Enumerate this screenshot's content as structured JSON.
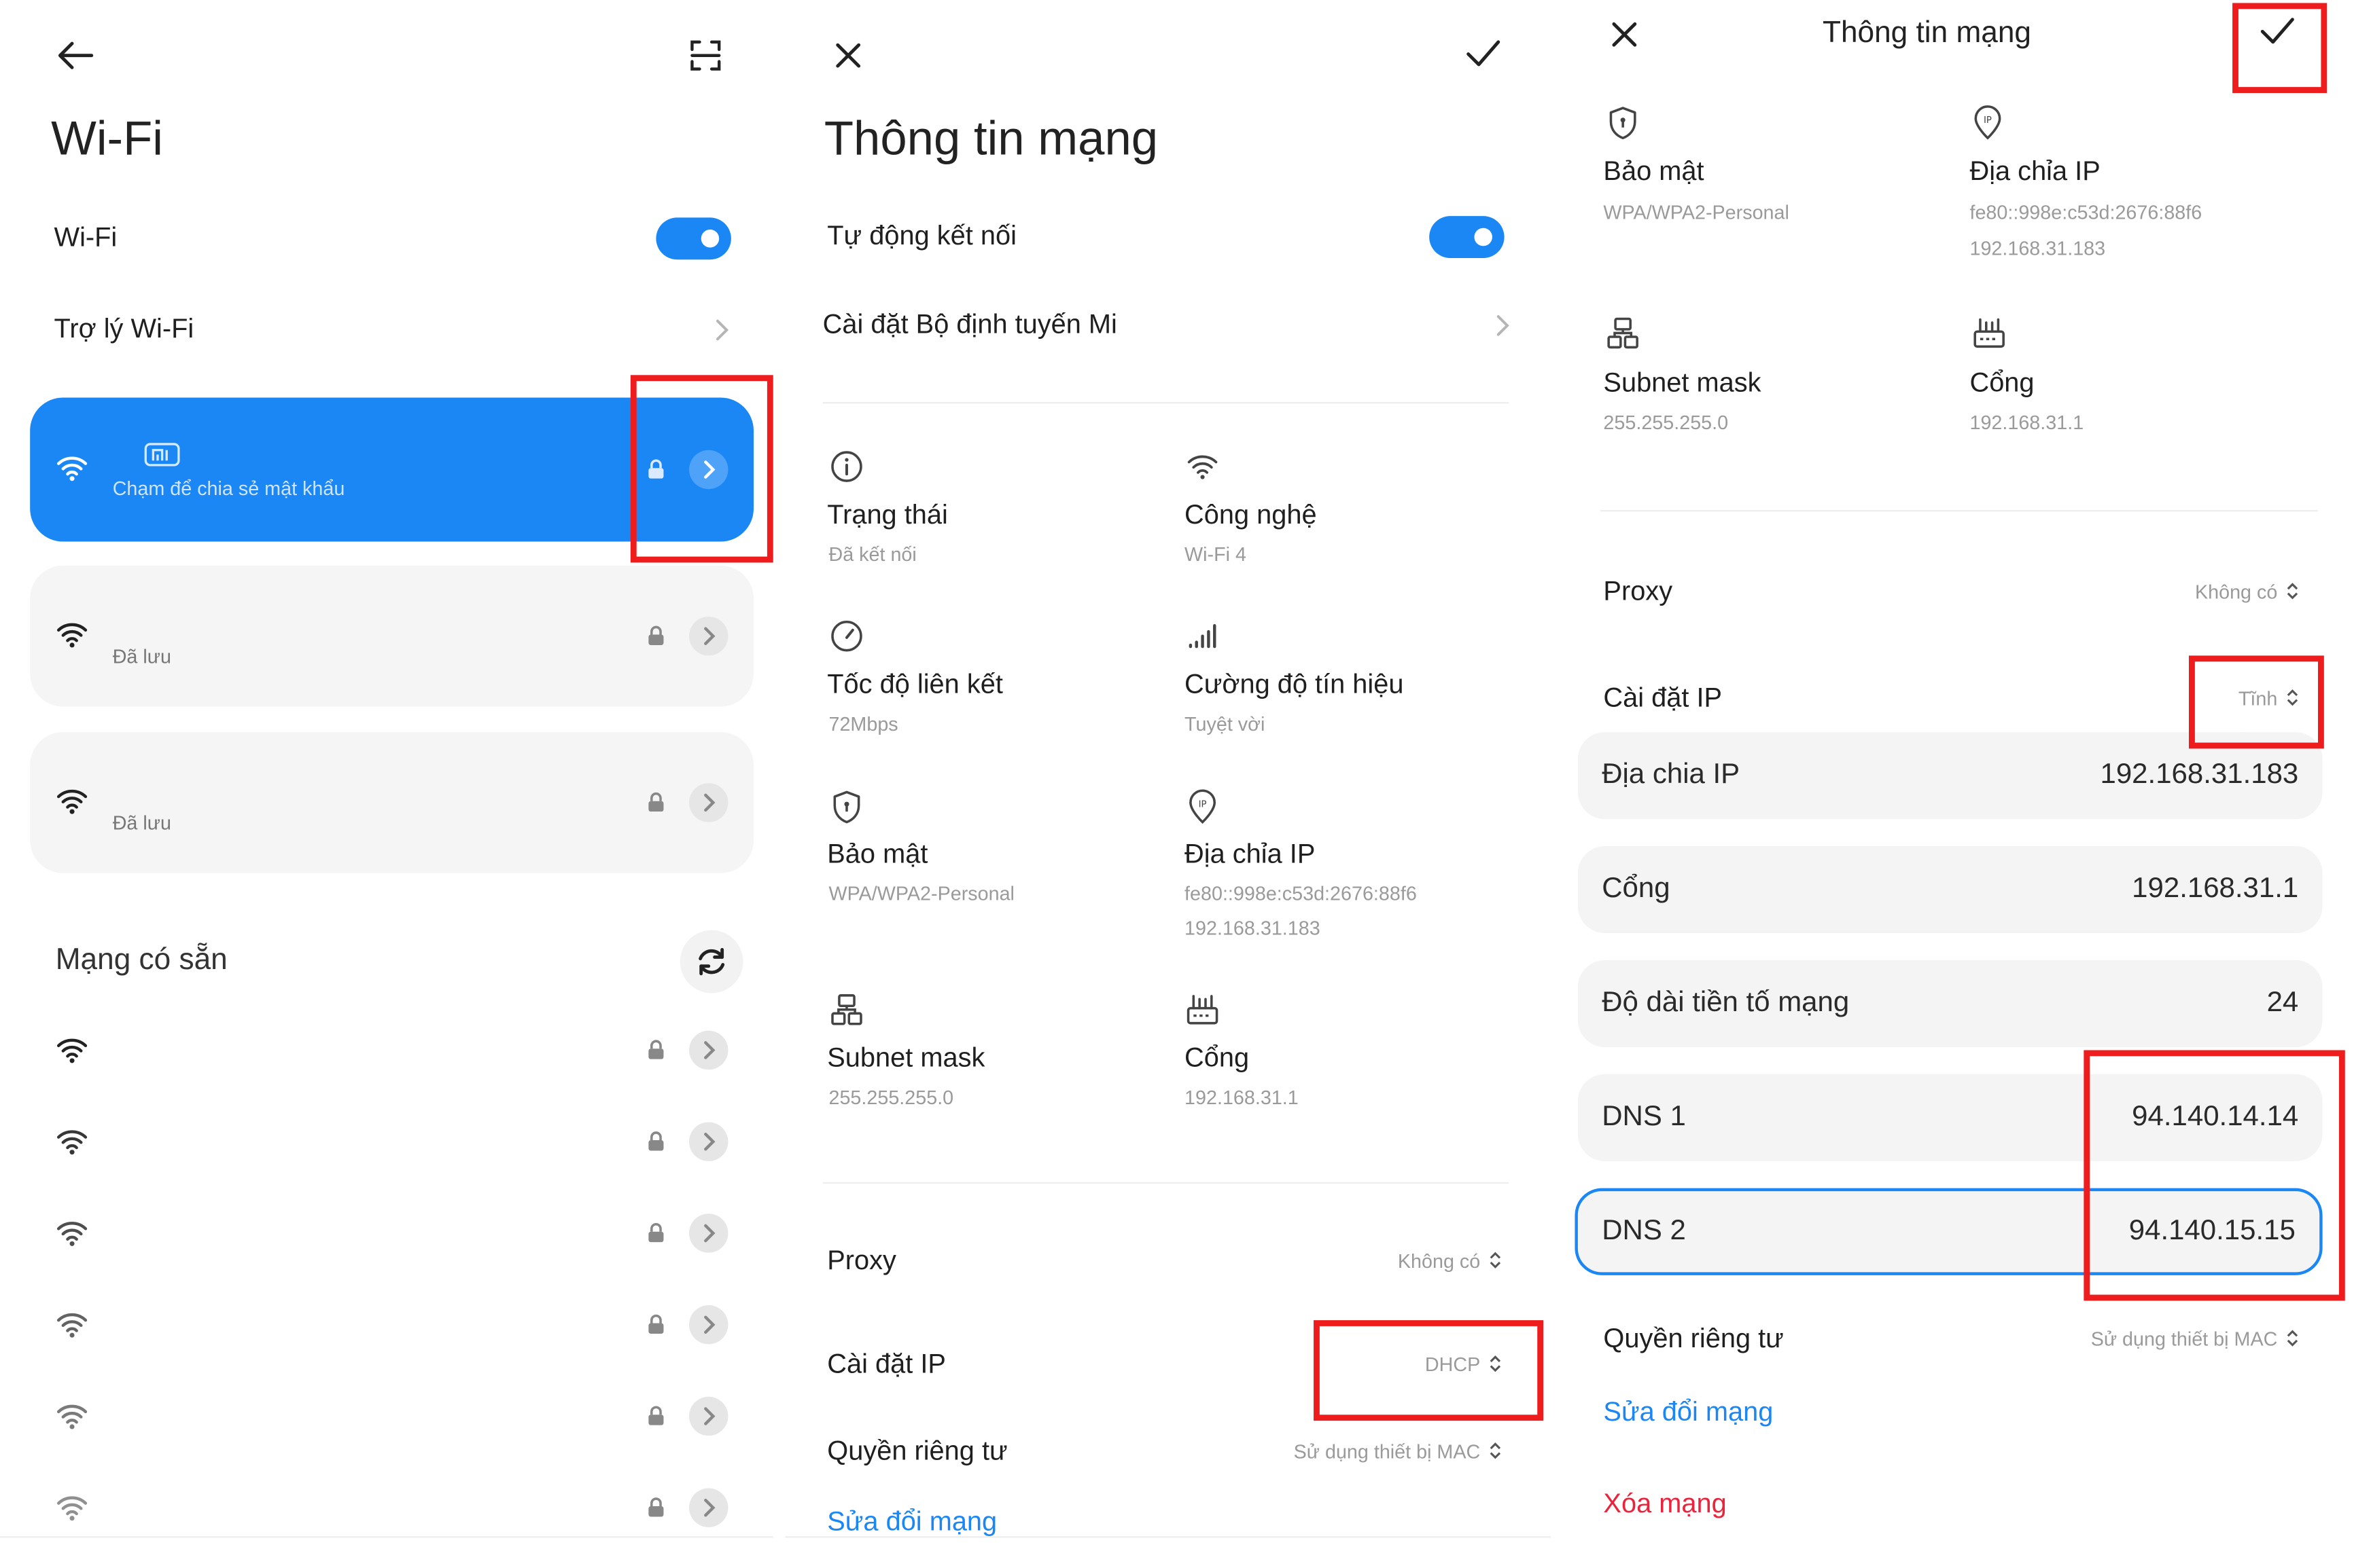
{
  "panel1": {
    "title": "Wi-Fi",
    "wifi_label": "Wi-Fi",
    "assistant_label": "Trợ lý Wi-Fi",
    "connected_subtitle": "Chạm để chia sẻ mật khẩu",
    "saved_networks": [
      "Đã lưu",
      "Đã lưu"
    ],
    "available_title": "Mạng có sẵn",
    "available_count_rows": 6
  },
  "panel2": {
    "title": "Thông tin mạng",
    "auto_connect_label": "Tự động kết nối",
    "router_label": "Cài đặt Bộ định tuyến Mi",
    "info": [
      {
        "label": "Trạng thái",
        "value": "Đã kết nối",
        "icon": "info-icon"
      },
      {
        "label": "Công nghệ",
        "value": "Wi-Fi 4",
        "icon": "wifi-icon"
      },
      {
        "label": "Tốc độ liên kết",
        "value": "72Mbps",
        "icon": "speed-gauge-icon"
      },
      {
        "label": "Cường độ tín hiệu",
        "value": "Tuyệt vời",
        "icon": "signal-bars-icon"
      },
      {
        "label": "Bảo mật",
        "value": "WPA/WPA2-Personal",
        "icon": "shield-icon"
      },
      {
        "label": "Địa chỉa IP",
        "value": "fe80::998e:c53d:2676:88f6",
        "value2": "192.168.31.183",
        "icon": "ip-pin-icon"
      },
      {
        "label": "Subnet mask",
        "value": "255.255.255.0",
        "icon": "subnet-icon"
      },
      {
        "label": "Cổng",
        "value": "192.168.31.1",
        "icon": "router-icon"
      }
    ],
    "proxy_label": "Proxy",
    "proxy_value": "Không có",
    "ip_settings_label": "Cài đặt IP",
    "ip_settings_value": "DHCP",
    "privacy_label": "Quyền riêng tư",
    "privacy_value": "Sử dụng thiết bị MAC",
    "modify_label": "Sửa đổi mạng"
  },
  "panel3": {
    "title": "Thông tin mạng",
    "info": [
      {
        "label": "Bảo mật",
        "value": "WPA/WPA2-Personal",
        "icon": "shield-icon"
      },
      {
        "label": "Địa chỉa IP",
        "value": "fe80::998e:c53d:2676:88f6",
        "value2": "192.168.31.183",
        "icon": "ip-pin-icon"
      },
      {
        "label": "Subnet mask",
        "value": "255.255.255.0",
        "icon": "subnet-icon"
      },
      {
        "label": "Cổng",
        "value": "192.168.31.1",
        "icon": "router-icon"
      }
    ],
    "proxy_label": "Proxy",
    "proxy_value": "Không có",
    "ip_settings_label": "Cài đặt IP",
    "ip_settings_value": "Tĩnh",
    "fields": [
      {
        "label": "Địa chia IP",
        "value": "192.168.31.183"
      },
      {
        "label": "Cổng",
        "value": "192.168.31.1"
      },
      {
        "label": "Độ dài tiền tố mạng",
        "value": "24"
      },
      {
        "label": "DNS 1",
        "value": "94.140.14.14"
      },
      {
        "label": "DNS 2",
        "value": "94.140.15.15"
      }
    ],
    "privacy_label": "Quyền riêng tư",
    "privacy_value": "Sử dụng thiết bị MAC",
    "modify_label": "Sửa đổi mạng",
    "delete_label": "Xóa mạng"
  },
  "colors": {
    "accent": "#1a87f5",
    "highlight_box": "#ee1c1c",
    "delete": "#e8253c"
  }
}
